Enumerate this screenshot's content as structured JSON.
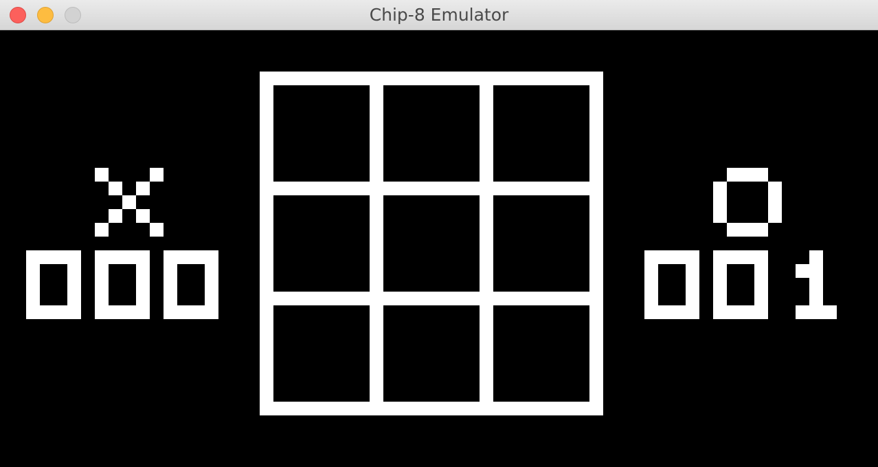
{
  "window": {
    "title": "Chip-8 Emulator"
  },
  "game": {
    "player_x": {
      "symbol": "X",
      "score": "000"
    },
    "player_o": {
      "symbol": "O",
      "score": "001"
    },
    "board": [
      [
        "",
        "",
        ""
      ],
      [
        "",
        "",
        ""
      ],
      [
        "",
        "",
        ""
      ]
    ]
  },
  "colors": {
    "foreground": "#ffffff",
    "background": "#000000"
  }
}
